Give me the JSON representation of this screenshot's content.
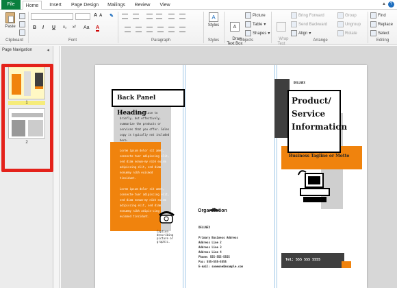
{
  "tabs": [
    "File",
    "Home",
    "Insert",
    "Page Design",
    "Mailings",
    "Review",
    "View"
  ],
  "clipboard": {
    "paste": "Paste",
    "group": "Clipboard"
  },
  "font": {
    "group": "Font",
    "size_grow": "A",
    "size_shrink": "A",
    "bold": "B",
    "italic": "I",
    "underline": "U",
    "subscript": "x₂",
    "superscript": "x²",
    "case": "Aa",
    "color": "A"
  },
  "paragraph": {
    "group": "Paragraph"
  },
  "styles": {
    "label": "Styles",
    "group": "Styles"
  },
  "objects": {
    "draw_text_box": "Draw\nText Box",
    "picture": "Picture",
    "table": "Table",
    "shapes": "Shapes",
    "group": "Objects"
  },
  "arrange": {
    "wrap_text": "Wrap\nText",
    "bring_forward": "Bring Forward",
    "send_backward": "Send Backward",
    "align": "Align",
    "group_btn": "Group",
    "ungroup": "Ungroup",
    "rotate": "Rotate",
    "group": "Arrange"
  },
  "editing": {
    "find": "Find",
    "replace": "Replace",
    "select": "Select",
    "group": "Editing"
  },
  "nav": {
    "title": "Page Navigation",
    "page1": "1",
    "page2": "2"
  },
  "brochure": {
    "back_heading": "Back Panel Heading",
    "back_body_1": "This is a good place to briefly, but effectively, summarize the products or services that you offer. Sales copy is typically not included here.",
    "back_body_2": "Lorem ipsum dolor sit amet, consecte-tuer adipiscing elit, sed diam nonum-my nibh euism adipiscing elit, sed diam nonummy nibh euismod tincidunt.",
    "back_body_3": "Lorem ipsum dolor sit amet, consecte-tuer adipiscing elit, sed diam nonum-my nibh euism adipiscing elit, sed diam nonummy nibh adipis-cing euismod tincidunt.",
    "caption": "Caption describing picture or graphic.",
    "org_name": "Organization",
    "org_label": "DELLNEX",
    "address_lines": [
      "Primary Business Address",
      "Address Line 2",
      "Address Line 3",
      "Address Line 4",
      "Phone: 555-555-5555",
      "Fax: 555-555-5555",
      "E-mail: someone@example.com"
    ],
    "front_label": "DELLNEX",
    "front_title": "Product/ Service Information",
    "tagline": "Business Tagline or Motto",
    "phone": "Tel: 555 555 5555"
  },
  "colors": {
    "file_tab": "#0a7f3e",
    "accent_orange": "#f0830d",
    "dark_gray": "#3f3f3f",
    "light_gray": "#bfbfbf",
    "highlight_red": "#e4221b"
  }
}
